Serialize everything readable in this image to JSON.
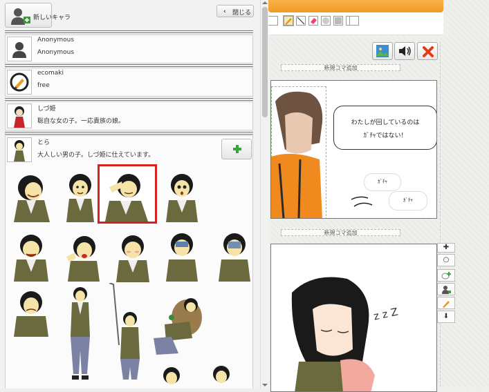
{
  "sidebar": {
    "new_character_label": "新しいキャラ",
    "close_label": "閉じる",
    "characters": [
      {
        "name": "Anonymous",
        "description": "Anonymous"
      },
      {
        "name": "ecomaki",
        "description": "free"
      },
      {
        "name": "しづ姫",
        "description": "聡自な女の子。一応貴族の娘。"
      },
      {
        "name": "とら",
        "description": "大人しい男の子。しづ姫に仕えています。"
      }
    ]
  },
  "editor": {
    "add_frame_label": "新規コマ追加",
    "speech_main": "わたしが回しているのは",
    "speech_main_2": "ｶﾞﾁｬではない！",
    "sfx_1": "ｶﾞﾁｬ",
    "sfx_2": "ｶﾞﾁｬ",
    "sleep_sfx": "z z Z"
  },
  "colors": {
    "accent_orange": "#ef9b20",
    "selected_outline": "#d6201f",
    "delete_red": "#e23b16"
  },
  "icons": [
    "add-user-icon",
    "chevron-left-icon",
    "person-icon",
    "pen-icon",
    "image-icon",
    "speaker-icon",
    "delete-icon",
    "plus-icon",
    "circle-icon",
    "add-bubble-icon",
    "add-character-icon",
    "pencil-icon",
    "down-arrow-icon"
  ]
}
